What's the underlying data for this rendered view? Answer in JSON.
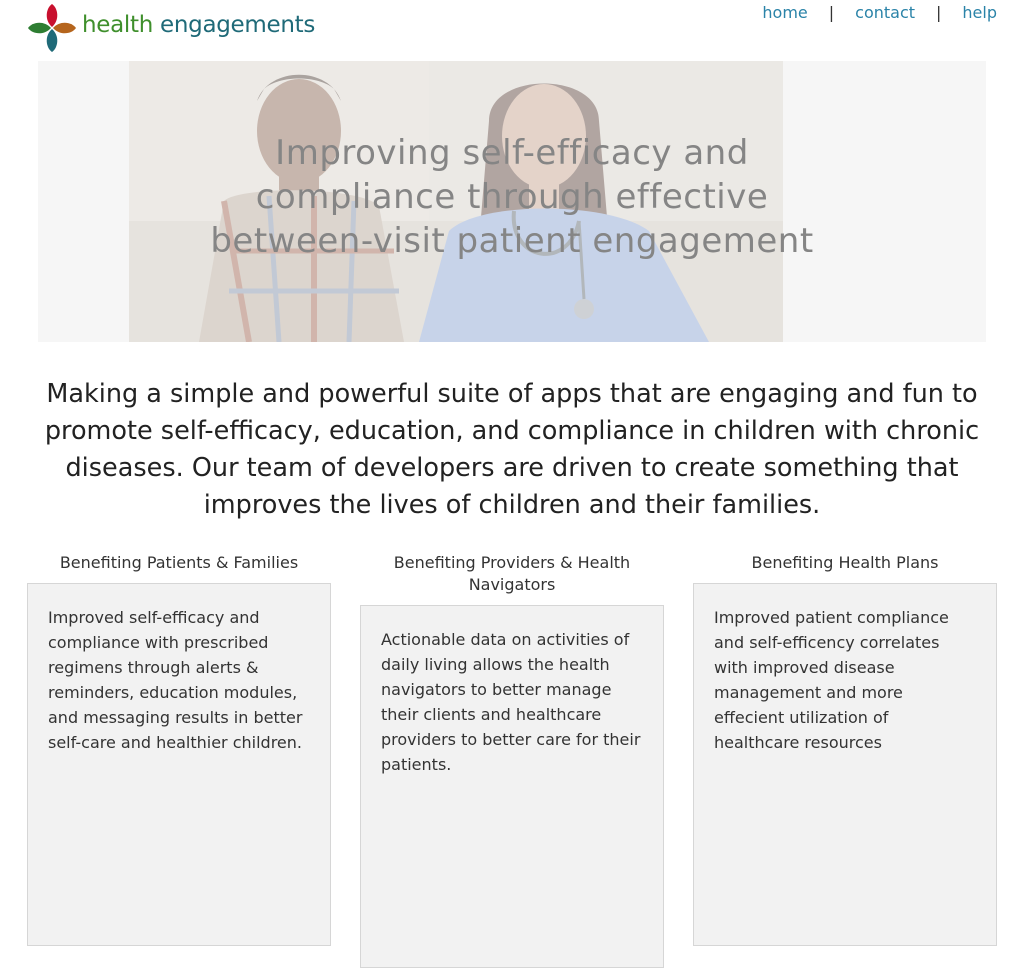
{
  "header": {
    "logo": {
      "word1": "health",
      "word2": "engagements",
      "colors": [
        "#c8102e",
        "#b5651d",
        "#2e7d32",
        "#1f6a78"
      ]
    },
    "nav": {
      "items": [
        {
          "label": "home"
        },
        {
          "label": "contact"
        },
        {
          "label": "help"
        }
      ],
      "separator": "|",
      "link_color": "#2a83a8"
    }
  },
  "hero": {
    "title_lines": [
      "Improving self-efficacy and",
      "compliance through effective",
      "between-visit patient engagement"
    ]
  },
  "intro": {
    "text": "Making a simple and powerful suite of apps that are engaging and fun to promote self-efficacy, education, and compliance in children with chronic diseases. Our team of developers are driven to create something that improves the lives of children and their families."
  },
  "benefits": [
    {
      "heading": "Benefiting Patients & Families",
      "body": "Improved self-efficacy and compliance with prescribed regimens through alerts & reminders, education modules, and messaging results in better self-care and healthier children."
    },
    {
      "heading": "Benefiting Providers & Health Navigators",
      "body": "Actionable data on activities of daily living allows the health navigators to better manage their clients and healthcare providers to better care for their patients."
    },
    {
      "heading": "Benefiting Health Plans",
      "body": "Improved patient compliance and self-efficency correlates with improved disease management and more effecient utilization of healthcare resources"
    }
  ]
}
